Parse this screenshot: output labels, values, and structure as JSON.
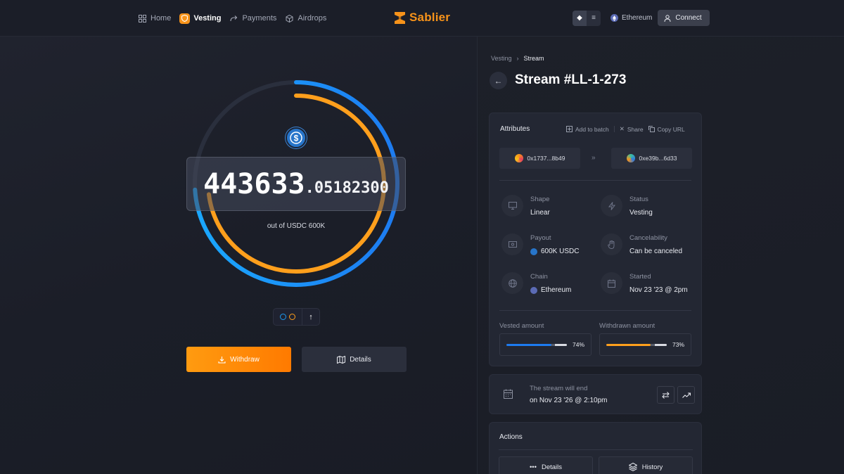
{
  "header": {
    "nav": [
      {
        "label": "Home",
        "icon": "grid-icon"
      },
      {
        "label": "Vesting",
        "icon": "shield-icon",
        "active": true
      },
      {
        "label": "Payments",
        "icon": "share-arrow-icon"
      },
      {
        "label": "Airdrops",
        "icon": "box-icon"
      }
    ],
    "logo_text": "Sablier",
    "chain": "Ethereum",
    "connect_label": "Connect",
    "brand_color": "#f7931a"
  },
  "stream_visual": {
    "amount_integer": "443633",
    "amount_decimal": ".05182300",
    "out_of_label": "out of USDC 600K",
    "withdraw_label": "Withdraw",
    "details_label": "Details",
    "streamed_ring_color": "#1d9bf0",
    "withdrawn_ring_color": "#ff9f1c"
  },
  "breadcrumb": {
    "parent": "Vesting",
    "current": "Stream"
  },
  "title": "Stream #LL-1-273",
  "attributes": {
    "heading": "Attributes",
    "actions": {
      "add_to_batch": "Add to batch",
      "share": "Share",
      "copy_url": "Copy URL"
    },
    "sender": "0x1737...8b49",
    "recipient": "0xe39b...6d33",
    "fields": {
      "shape": {
        "label": "Shape",
        "value": "Linear"
      },
      "status": {
        "label": "Status",
        "value": "Vesting"
      },
      "payout": {
        "label": "Payout",
        "value": "600K USDC"
      },
      "cancelability": {
        "label": "Cancelability",
        "value": "Can be canceled"
      },
      "chain": {
        "label": "Chain",
        "value": "Ethereum"
      },
      "started": {
        "label": "Started",
        "value": "Nov 23 '23 @ 2pm"
      }
    },
    "vested": {
      "label": "Vested amount",
      "percent_text": "74%",
      "percent": 74,
      "color": "#1d7bf0"
    },
    "withdrawn": {
      "label": "Withdrawn amount",
      "percent_text": "73%",
      "percent": 73,
      "color": "#ff9f1c"
    }
  },
  "end_card": {
    "label": "The stream will end",
    "value": "on Nov 23 '26 @ 2:10pm"
  },
  "actions_card": {
    "heading": "Actions",
    "details_label": "Details",
    "history_label": "History"
  }
}
